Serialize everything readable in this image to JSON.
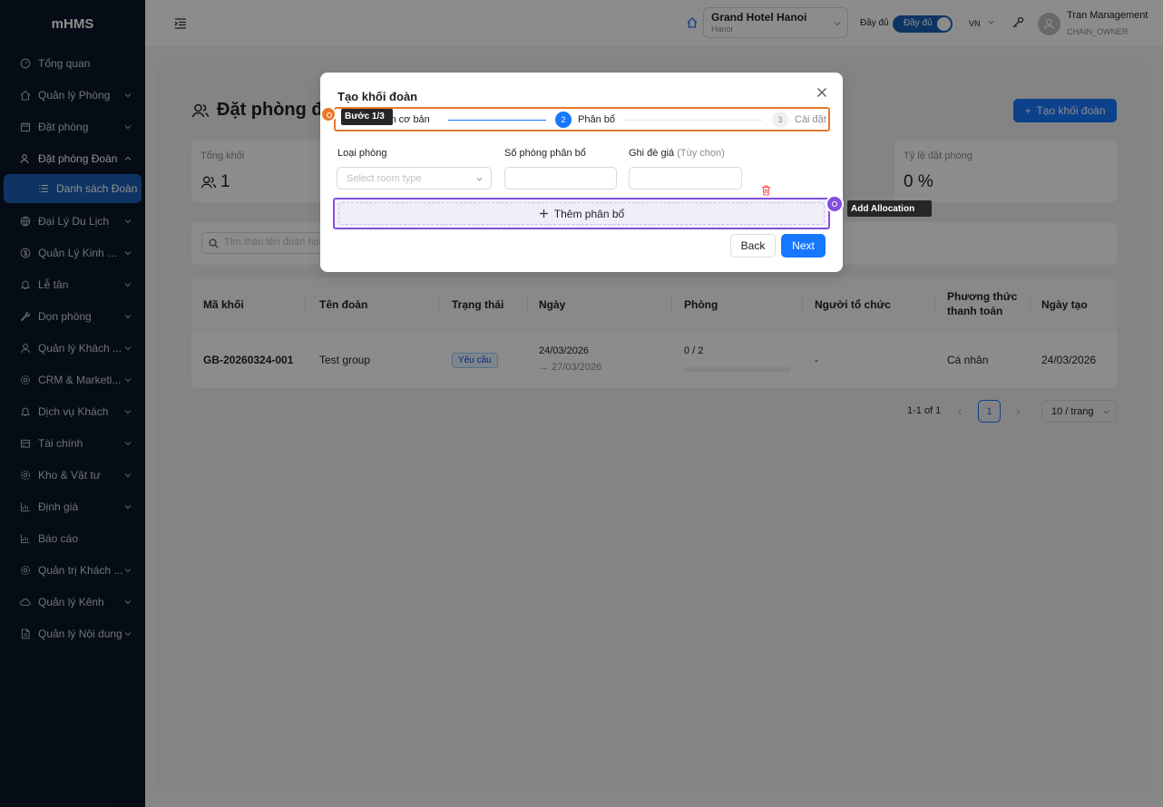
{
  "app": {
    "logo": "mHMS"
  },
  "sidebar": {
    "items": [
      {
        "label": "Tổng quan",
        "icon": "dashboard-icon",
        "has_children": false
      },
      {
        "label": "Quản lý Phòng",
        "icon": "home-icon",
        "has_children": true
      },
      {
        "label": "Đặt phòng",
        "icon": "calendar-icon",
        "has_children": true
      },
      {
        "label": "Đặt phòng Đoàn",
        "icon": "users-icon",
        "has_children": true,
        "expanded": true
      },
      {
        "label": "Đại Lý Du Lịch",
        "icon": "globe-icon",
        "has_children": true
      },
      {
        "label": "Quản Lý Kinh D...",
        "icon": "dollar-icon",
        "has_children": true
      },
      {
        "label": "Lễ tân",
        "icon": "bell-icon",
        "has_children": true
      },
      {
        "label": "Dọn phòng",
        "icon": "tool-icon",
        "has_children": true
      },
      {
        "label": "Quản lý Khách ...",
        "icon": "user-icon",
        "has_children": true
      },
      {
        "label": "CRM & Marketi...",
        "icon": "settings-icon",
        "has_children": true
      },
      {
        "label": "Dịch vụ Khách",
        "icon": "bell-icon",
        "has_children": true
      },
      {
        "label": "Tài chính",
        "icon": "wallet-icon",
        "has_children": true
      },
      {
        "label": "Kho & Vật tư",
        "icon": "settings-icon",
        "has_children": true
      },
      {
        "label": "Định giá",
        "icon": "chart-icon",
        "has_children": true
      },
      {
        "label": "Báo cáo",
        "icon": "chart-icon",
        "has_children": false
      },
      {
        "label": "Quản trị Khách ...",
        "icon": "settings-icon",
        "has_children": true
      },
      {
        "label": "Quản lý Kênh",
        "icon": "cloud-icon",
        "has_children": true
      },
      {
        "label": "Quản lý Nội dung",
        "icon": "file-icon",
        "has_children": true
      }
    ],
    "sub_item": {
      "label": "Danh sách Đoàn",
      "icon": "list-icon"
    }
  },
  "header": {
    "hotel_name": "Grand Hotel Hanoi",
    "hotel_city": "Hanoi",
    "mode_label": "Đầy đủ",
    "mode_toggle_label": "Đầy đủ",
    "language": "VN",
    "user_name": "Tran Management",
    "user_role": "CHAIN_OWNER"
  },
  "page": {
    "title": "Đặt phòng đo",
    "create_button": "Tạo khối đoàn",
    "stats": [
      {
        "label": "Tổng khối",
        "value": "1"
      },
      {
        "label": "Tỷ lệ đặt phòng",
        "value": "0 %"
      }
    ],
    "search_placeholder": "Tìm theo tên đoàn hoặc mã"
  },
  "table": {
    "columns": [
      "Mã khối",
      "Tên đoàn",
      "Trạng thái",
      "Ngày",
      "Phòng",
      "Người tổ chức",
      "Phương thức thanh toán",
      "Ngày tạo"
    ],
    "rows": [
      {
        "code": "GB-20260324-001",
        "name": "Test group",
        "status": "Yêu cầu",
        "date_from": "24/03/2026",
        "date_to": "→ 27/03/2026",
        "rooms": "0 / 2",
        "rooms_progress": 0,
        "organizer": "-",
        "payment": "Cá nhân",
        "created": "24/03/2026"
      }
    ]
  },
  "pagination": {
    "range": "1-1 of 1",
    "current_page": "1",
    "page_size": "10 / trang"
  },
  "modal": {
    "title": "Tạo khối đoàn",
    "steps": [
      {
        "number": "1",
        "label": "Thông tin cơ bản",
        "visible_label": "tin cơ bản",
        "status": "done"
      },
      {
        "number": "2",
        "label": "Phân bổ",
        "status": "current"
      },
      {
        "number": "3",
        "label": "Cài đặt",
        "status": "pending"
      }
    ],
    "step_tooltip": "Bước 1/3",
    "fields": {
      "room_type_label": "Loại phòng",
      "room_type_placeholder": "Select room type",
      "rooms_label": "Số phòng phân bổ",
      "rooms_value": "",
      "rate_label": "Ghi đè giá",
      "rate_optional": "(Tùy chọn)",
      "rate_value": ""
    },
    "add_allocation_label": "Thêm phân bổ",
    "add_allocation_tooltip": "Add Allocation",
    "back_button": "Back",
    "next_button": "Next"
  },
  "colors": {
    "sidebar_bg": "#0b1727",
    "sidebar_active": "#1a5fb4",
    "primary": "#1677ff",
    "step_highlight": "#e8782b",
    "allocation_highlight": "#8250df"
  }
}
